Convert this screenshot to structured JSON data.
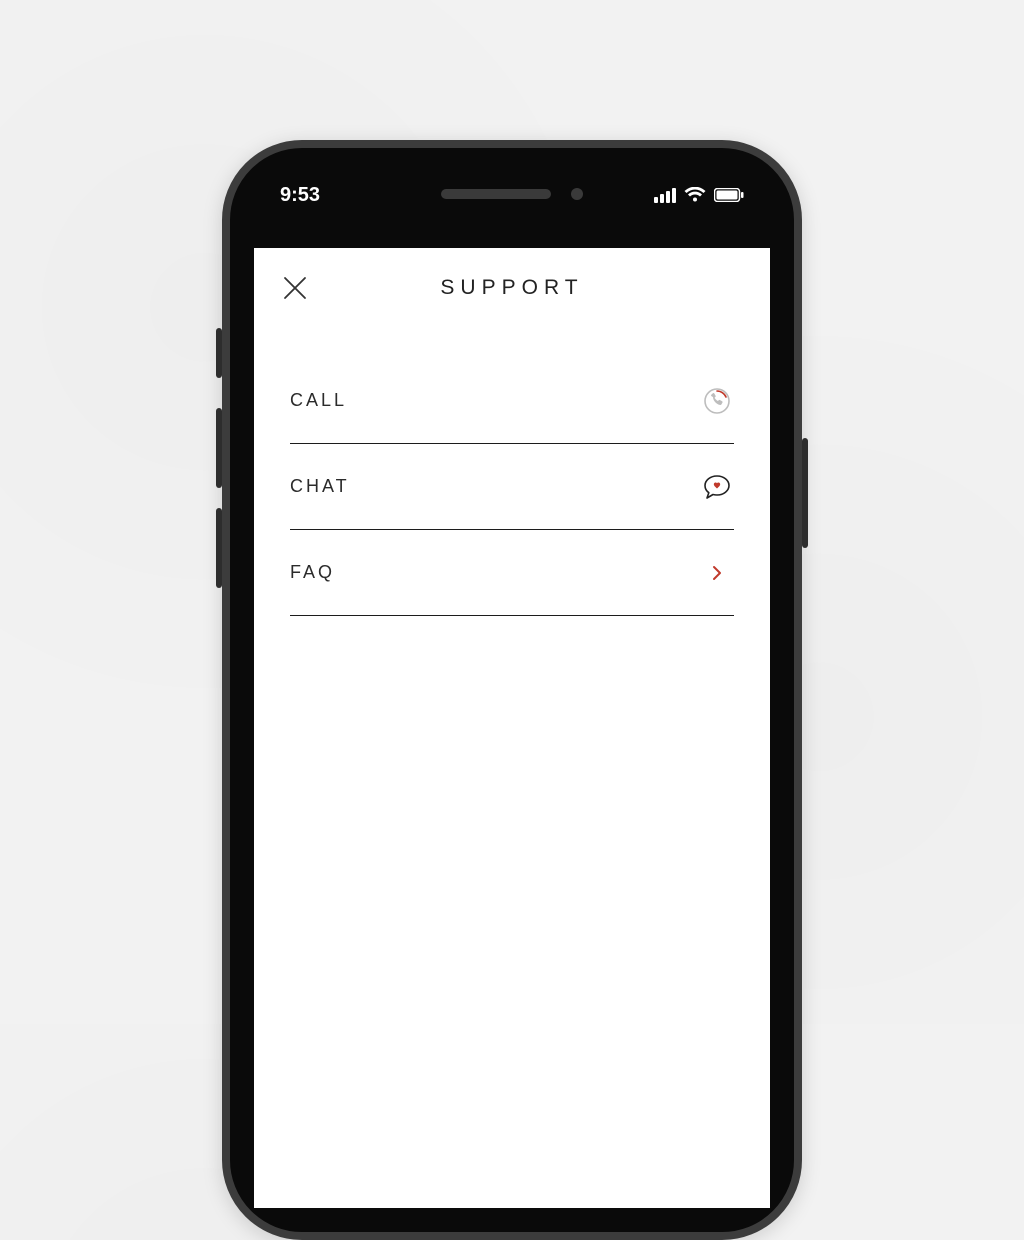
{
  "status": {
    "time": "9:53"
  },
  "header": {
    "title": "SUPPORT"
  },
  "menu": {
    "items": [
      {
        "label": "CALL",
        "icon": "phone-circle-icon"
      },
      {
        "label": "CHAT",
        "icon": "chat-bubble-heart-icon"
      },
      {
        "label": "FAQ",
        "icon": "chevron-right-icon"
      }
    ]
  },
  "colors": {
    "accent": "#c0392b"
  }
}
